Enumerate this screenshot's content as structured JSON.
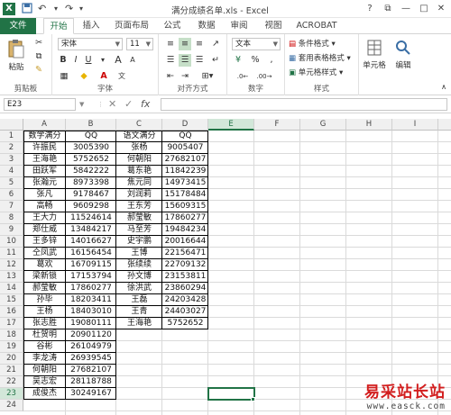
{
  "window": {
    "title": "满分成绩名单.xls - Excel",
    "qat_save_icon": "save-icon",
    "qat_undo": "↶",
    "qat_redo": "↷",
    "help": "?",
    "restore": "⧉",
    "minimize": "—",
    "maximize": "□",
    "close": "✕"
  },
  "ribbon_tabs": [
    "文件",
    "开始",
    "插入",
    "页面布局",
    "公式",
    "数据",
    "审阅",
    "视图",
    "ACROBAT"
  ],
  "ribbon": {
    "clipboard": {
      "paste": "粘贴",
      "label": "剪贴板"
    },
    "font": {
      "name": "宋体",
      "size": "11",
      "bold": "B",
      "italic": "I",
      "underline": "U",
      "grow": "A",
      "shrink": "A",
      "label": "字体"
    },
    "alignment": {
      "label": "对齐方式"
    },
    "number": {
      "format": "文本",
      "percent": "%",
      "comma": ",",
      "label": "数字"
    },
    "styles": {
      "conditional": "条件格式",
      "table": "套用表格格式",
      "cell": "单元格样式",
      "label": "样式"
    },
    "cells": {
      "label": "单元格"
    },
    "editing": {
      "label": "编辑"
    }
  },
  "formula_bar": {
    "name_box": "E23",
    "cancel": "✕",
    "enter": "✓",
    "fx": "fx",
    "value": ""
  },
  "sheet": {
    "columns": [
      "A",
      "B",
      "C",
      "D",
      "E",
      "F",
      "G",
      "H",
      "I"
    ],
    "rows": [
      "1",
      "2",
      "3",
      "4",
      "5",
      "6",
      "7",
      "8",
      "9",
      "10",
      "11",
      "12",
      "13",
      "14",
      "15",
      "16",
      "17",
      "18",
      "19",
      "20",
      "21",
      "22",
      "23",
      "24"
    ],
    "selected_cell": "E23",
    "col_a": [
      "数学满分",
      "许振民",
      "王海艳",
      "田跃军",
      "张瀚元",
      "张凡",
      "高畅",
      "王大力",
      "郑仕威",
      "王多锌",
      "仝凤武",
      "葛欢",
      "梁新锁",
      "郝莹敏",
      "孙毕",
      "王杨",
      "张志胜",
      "杜贺明",
      "谷彬",
      "李龙涛",
      "何朝阳",
      "吴志宏",
      "成俊杰"
    ],
    "col_b": [
      "QQ",
      "3005390",
      "5752652",
      "5842222",
      "8973398",
      "9178467",
      "9609298",
      "11524614",
      "13484217",
      "14016627",
      "16156454",
      "16709115",
      "17153794",
      "17860277",
      "18203411",
      "18403010",
      "19080111",
      "20901120",
      "26104979",
      "26939545",
      "27682107",
      "28118788",
      "30249167"
    ],
    "col_c": [
      "语文满分",
      "张杨",
      "何朝阳",
      "葛东艳",
      "焦元同",
      "刘润莉",
      "王东芳",
      "郝莹敏",
      "马至芳",
      "史宇鹏",
      "王博",
      "张续续",
      "孙文博",
      "徐洪武",
      "王磊",
      "王青",
      "王海艳"
    ],
    "col_d": [
      "QQ",
      "9005407",
      "27682107",
      "11842239",
      "14973415",
      "15178484",
      "15609315",
      "17860277",
      "19484234",
      "20016644",
      "22156471",
      "22709132",
      "23153811",
      "23860294",
      "24203428",
      "24403027",
      "5752652"
    ]
  },
  "watermark": {
    "line1": "易采站长站",
    "line2": "www.easck.com"
  }
}
